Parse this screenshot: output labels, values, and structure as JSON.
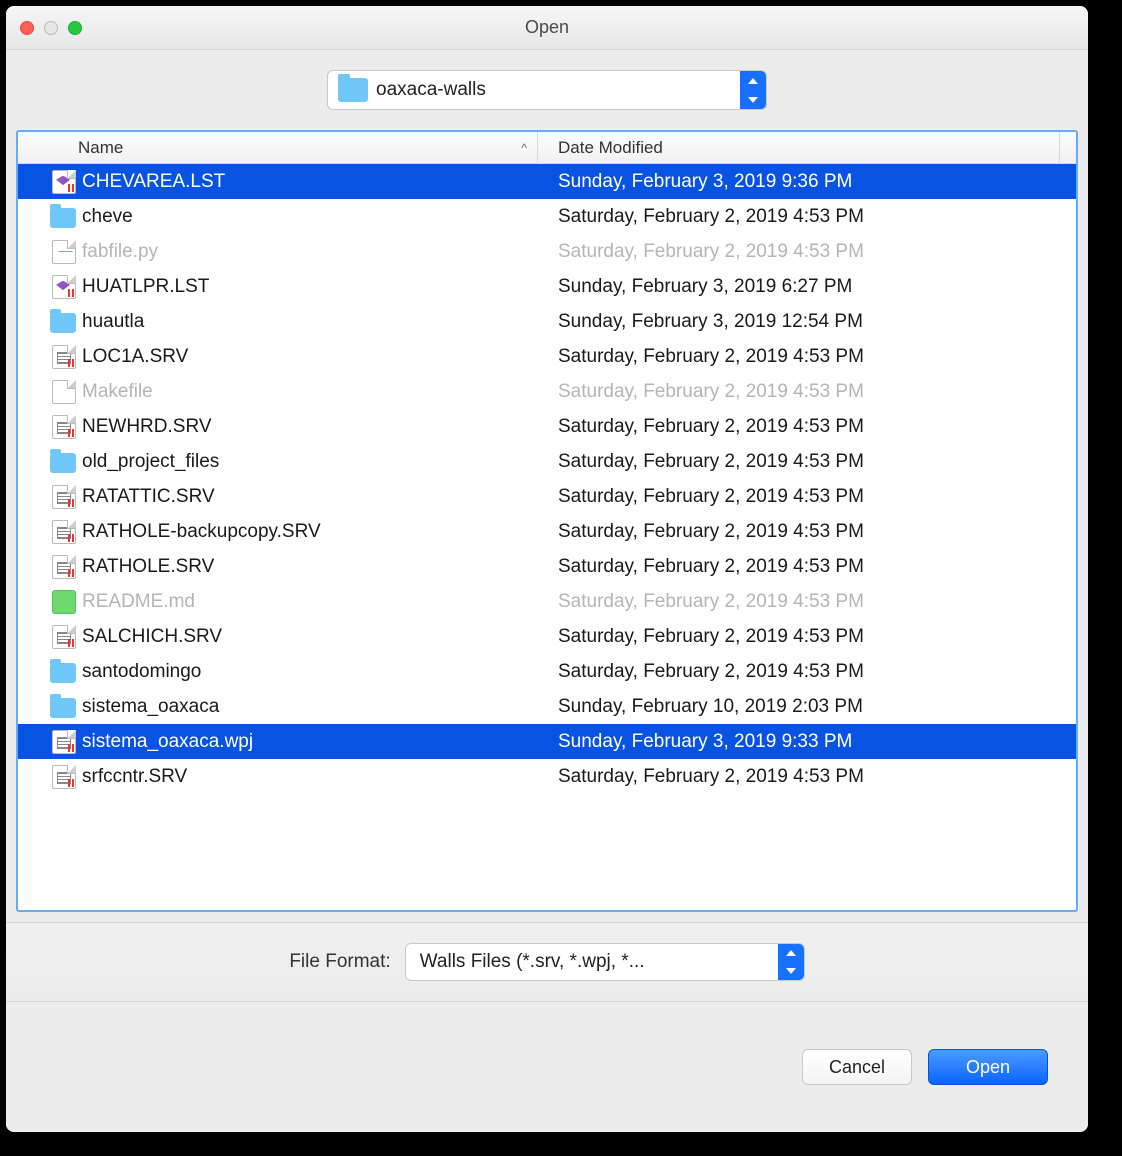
{
  "window": {
    "title": "Open"
  },
  "location": {
    "folder_name": "oaxaca-walls"
  },
  "columns": {
    "name": "Name",
    "date": "Date Modified",
    "sort_indicator": "^"
  },
  "files": [
    {
      "name": "CHEVAREA.LST",
      "date": "Sunday, February 3, 2019 9:36 PM",
      "icon": "vs",
      "selected": true,
      "disabled": false
    },
    {
      "name": "cheve",
      "date": "Saturday, February 2, 2019 4:53 PM",
      "icon": "folder",
      "selected": false,
      "disabled": false
    },
    {
      "name": "fabfile.py",
      "date": "Saturday, February 2, 2019 4:53 PM",
      "icon": "py",
      "selected": false,
      "disabled": true
    },
    {
      "name": "HUATLPR.LST",
      "date": "Sunday, February 3, 2019 6:27 PM",
      "icon": "vs",
      "selected": false,
      "disabled": false
    },
    {
      "name": "huautla",
      "date": "Sunday, February 3, 2019 12:54 PM",
      "icon": "folder",
      "selected": false,
      "disabled": false
    },
    {
      "name": "LOC1A.SRV",
      "date": "Saturday, February 2, 2019 4:53 PM",
      "icon": "srv",
      "selected": false,
      "disabled": false
    },
    {
      "name": "Makefile",
      "date": "Saturday, February 2, 2019 4:53 PM",
      "icon": "blank",
      "selected": false,
      "disabled": true
    },
    {
      "name": "NEWHRD.SRV",
      "date": "Saturday, February 2, 2019 4:53 PM",
      "icon": "srv",
      "selected": false,
      "disabled": false
    },
    {
      "name": "old_project_files",
      "date": "Saturday, February 2, 2019 4:53 PM",
      "icon": "folder",
      "selected": false,
      "disabled": false
    },
    {
      "name": "RATATTIC.SRV",
      "date": "Saturday, February 2, 2019 4:53 PM",
      "icon": "srv",
      "selected": false,
      "disabled": false
    },
    {
      "name": "RATHOLE-backupcopy.SRV",
      "date": "Saturday, February 2, 2019 4:53 PM",
      "icon": "srv",
      "selected": false,
      "disabled": false
    },
    {
      "name": "RATHOLE.SRV",
      "date": "Saturday, February 2, 2019 4:53 PM",
      "icon": "srv",
      "selected": false,
      "disabled": false
    },
    {
      "name": "README.md",
      "date": "Saturday, February 2, 2019 4:53 PM",
      "icon": "atom",
      "selected": false,
      "disabled": true
    },
    {
      "name": "SALCHICH.SRV",
      "date": "Saturday, February 2, 2019 4:53 PM",
      "icon": "srv",
      "selected": false,
      "disabled": false
    },
    {
      "name": "santodomingo",
      "date": "Saturday, February 2, 2019 4:53 PM",
      "icon": "folder",
      "selected": false,
      "disabled": false
    },
    {
      "name": "sistema_oaxaca",
      "date": "Sunday, February 10, 2019 2:03 PM",
      "icon": "folder",
      "selected": false,
      "disabled": false
    },
    {
      "name": "sistema_oaxaca.wpj",
      "date": "Sunday, February 3, 2019 9:33 PM",
      "icon": "srv",
      "selected": true,
      "disabled": false
    },
    {
      "name": "srfccntr.SRV",
      "date": "Saturday, February 2, 2019 4:53 PM",
      "icon": "srv",
      "selected": false,
      "disabled": false
    }
  ],
  "format": {
    "label": "File Format:",
    "value": "Walls Files (*.srv, *.wpj, *..."
  },
  "buttons": {
    "cancel": "Cancel",
    "open": "Open"
  }
}
